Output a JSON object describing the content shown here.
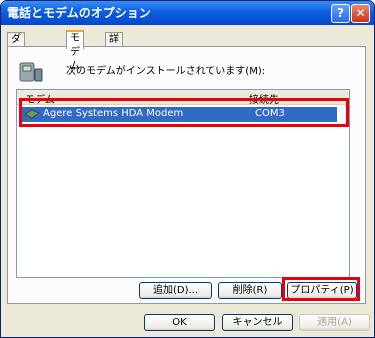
{
  "window": {
    "title": "電話とモデムのオプション",
    "help_glyph": "?",
    "close_glyph": "✕"
  },
  "tabs": [
    {
      "label": "ダイヤル情報"
    },
    {
      "label": "モデム"
    },
    {
      "label": "詳細設定"
    }
  ],
  "panel": {
    "description": "次のモデムがインストールされています(M):"
  },
  "list": {
    "columns": [
      "モデム",
      "接続先"
    ],
    "rows": [
      {
        "modem": "Agere Systems HDA Modem",
        "port": "COM3"
      }
    ]
  },
  "panel_buttons": {
    "add": "追加(D)...",
    "remove": "削除(R)",
    "properties": "プロパティ(P)"
  },
  "dialog_buttons": {
    "ok": "OK",
    "cancel": "キャンセル",
    "apply": "適用(A)"
  },
  "colors": {
    "highlight": "#e8000a",
    "selection": "#316ac5",
    "title_bar": "#0a5fe0"
  }
}
